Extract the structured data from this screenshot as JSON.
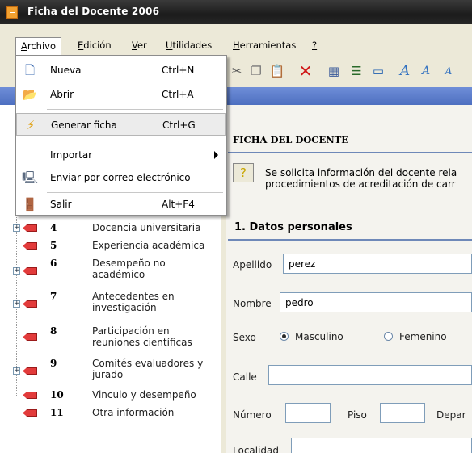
{
  "window": {
    "title": "Ficha del Docente 2006"
  },
  "menubar": {
    "items": [
      {
        "label": "Archivo",
        "mnemonic": "A"
      },
      {
        "label": "Edición",
        "mnemonic": "E"
      },
      {
        "label": "Ver",
        "mnemonic": "V"
      },
      {
        "label": "Utilidades",
        "mnemonic": "U"
      },
      {
        "label": "Herramientas",
        "mnemonic": "H"
      },
      {
        "label": "?",
        "mnemonic": "?"
      }
    ]
  },
  "dropdown": {
    "items": [
      {
        "label": "Nueva",
        "shortcut": "Ctrl+N",
        "icon": "new-document-icon"
      },
      {
        "label": "Abrir",
        "shortcut": "Ctrl+A",
        "icon": "open-folder-icon"
      },
      {
        "label": "Generar ficha",
        "shortcut": "Ctrl+G",
        "icon": "lightning-icon"
      },
      {
        "label": "Importar",
        "shortcut": "",
        "icon": ""
      },
      {
        "label": "Enviar por correo electrónico",
        "shortcut": "",
        "icon": "mail-send-icon"
      },
      {
        "label": "Salir",
        "shortcut": "Alt+F4",
        "icon": "exit-door-icon"
      }
    ]
  },
  "tree": [
    {
      "num": "4",
      "label": "Docencia universitaria",
      "expandable": true
    },
    {
      "num": "5",
      "label": "Experiencia académica",
      "expandable": false
    },
    {
      "num": "6",
      "label": "Desempeño no académico",
      "expandable": true
    },
    {
      "num": "7",
      "label": "Antecedentes en investigación",
      "expandable": true
    },
    {
      "num": "8",
      "label": "Participación en reuniones científicas",
      "expandable": false
    },
    {
      "num": "9",
      "label": "Comités evaluadores y jurado",
      "expandable": true
    },
    {
      "num": "10",
      "label": "Vinculo y desempeño",
      "expandable": false
    },
    {
      "num": "11",
      "label": "Otra información",
      "expandable": false
    }
  ],
  "form": {
    "header": "FICHA DEL DOCENTE",
    "info_line1": "Se solicita información del docente rela",
    "info_line2": "procedimientos de acreditación de carr",
    "section": "1. Datos personales",
    "apellido_label": "Apellido",
    "apellido_value": "perez",
    "nombre_label": "Nombre",
    "nombre_value": "pedro",
    "sexo_label": "Sexo",
    "sexo_opt1": "Masculino",
    "sexo_opt2": "Femenino",
    "calle_label": "Calle",
    "calle_value": "",
    "numero_label": "Número",
    "numero_value": "",
    "piso_label": "Piso",
    "piso_value": "",
    "depar_label": "Depar",
    "localidad_label": "Localidad"
  }
}
